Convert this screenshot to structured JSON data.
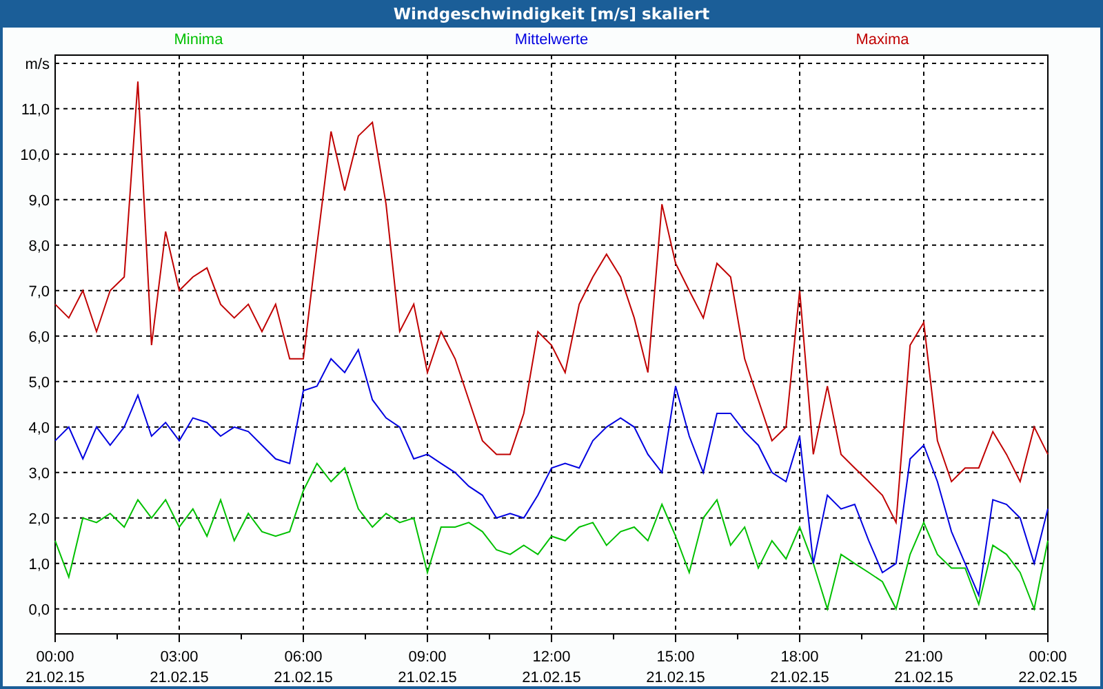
{
  "chart_data": {
    "type": "line",
    "title": "Windgeschwindigkeit [m/s] skaliert",
    "x": [
      0,
      0.33,
      0.67,
      1,
      1.33,
      1.67,
      2,
      2.33,
      2.67,
      3,
      3.33,
      3.67,
      4,
      4.33,
      4.67,
      5,
      5.33,
      5.67,
      6,
      6.33,
      6.67,
      7,
      7.33,
      7.67,
      8,
      8.33,
      8.67,
      9,
      9.33,
      9.67,
      10,
      10.33,
      10.67,
      11,
      11.33,
      11.67,
      12,
      12.33,
      12.67,
      13,
      13.33,
      13.67,
      14,
      14.33,
      14.67,
      15,
      15.33,
      15.67,
      16,
      16.33,
      16.67,
      17,
      17.33,
      17.67,
      18,
      18.33,
      18.67,
      19,
      19.33,
      19.67,
      20,
      20.33,
      20.67,
      21,
      21.33,
      21.67,
      22,
      22.33,
      22.67,
      23,
      23.33,
      23.67,
      24
    ],
    "series": [
      {
        "name": "Minima",
        "color": "#00c000",
        "values": [
          1.5,
          0.7,
          2.0,
          1.9,
          2.1,
          1.8,
          2.4,
          2.0,
          2.4,
          1.8,
          2.2,
          1.6,
          2.4,
          1.5,
          2.1,
          1.7,
          1.6,
          1.7,
          2.6,
          3.2,
          2.8,
          3.1,
          2.2,
          1.8,
          2.1,
          1.9,
          2.0,
          0.8,
          1.8,
          1.8,
          1.9,
          1.7,
          1.3,
          1.2,
          1.4,
          1.2,
          1.6,
          1.5,
          1.8,
          1.9,
          1.4,
          1.7,
          1.8,
          1.5,
          2.3,
          1.6,
          0.8,
          2.0,
          2.4,
          1.4,
          1.8,
          0.9,
          1.5,
          1.1,
          1.8,
          1.0,
          0.0,
          1.2,
          1.0,
          0.8,
          0.6,
          0.0,
          1.2,
          1.9,
          1.2,
          0.9,
          0.9,
          0.1,
          1.4,
          1.2,
          0.8,
          0.0,
          1.5
        ]
      },
      {
        "name": "Mittelwerte",
        "color": "#0000e0",
        "values": [
          3.7,
          4.0,
          3.3,
          4.0,
          3.6,
          4.0,
          4.7,
          3.8,
          4.1,
          3.7,
          4.2,
          4.1,
          3.8,
          4.0,
          3.9,
          3.6,
          3.3,
          3.2,
          4.8,
          4.9,
          5.5,
          5.2,
          5.7,
          4.6,
          4.2,
          4.0,
          3.3,
          3.4,
          3.2,
          3.0,
          2.7,
          2.5,
          2.0,
          2.1,
          2.0,
          2.5,
          3.1,
          3.2,
          3.1,
          3.7,
          4.0,
          4.2,
          4.0,
          3.4,
          3.0,
          4.9,
          3.8,
          3.0,
          4.3,
          4.3,
          3.9,
          3.6,
          3.0,
          2.8,
          3.8,
          1.0,
          2.5,
          2.2,
          2.3,
          1.5,
          0.8,
          1.0,
          3.3,
          3.6,
          2.8,
          1.7,
          1.0,
          0.3,
          2.4,
          2.3,
          2.0,
          1.0,
          2.2
        ]
      },
      {
        "name": "Maxima",
        "color": "#c00000",
        "values": [
          6.7,
          6.4,
          7.0,
          6.1,
          7.0,
          7.3,
          11.6,
          5.8,
          8.3,
          7.0,
          7.3,
          7.5,
          6.7,
          6.4,
          6.7,
          6.1,
          6.7,
          5.5,
          5.5,
          8.0,
          10.5,
          9.2,
          10.4,
          10.7,
          8.9,
          6.1,
          6.7,
          5.2,
          6.1,
          5.5,
          4.6,
          3.7,
          3.4,
          3.4,
          4.3,
          6.1,
          5.8,
          5.2,
          6.7,
          7.3,
          7.8,
          7.3,
          6.4,
          5.2,
          8.9,
          7.6,
          7.0,
          6.4,
          7.6,
          7.3,
          5.5,
          4.6,
          3.7,
          4.0,
          7.0,
          3.4,
          4.9,
          3.4,
          3.1,
          2.8,
          2.5,
          1.9,
          5.8,
          6.3,
          3.7,
          2.8,
          3.1,
          3.1,
          3.9,
          3.4,
          2.8,
          4.0,
          3.4
        ]
      }
    ],
    "xlim": [
      0,
      24
    ],
    "ylim": [
      -0.55,
      12.18
    ],
    "grid": true,
    "xticks": [
      {
        "value": 0,
        "label": "00:00"
      },
      {
        "value": 3,
        "label": "03:00"
      },
      {
        "value": 6,
        "label": "06:00"
      },
      {
        "value": 9,
        "label": "09:00"
      },
      {
        "value": 12,
        "label": "12:00"
      },
      {
        "value": 15,
        "label": "15:00"
      },
      {
        "value": 18,
        "label": "18:00"
      },
      {
        "value": 21,
        "label": "21:00"
      },
      {
        "value": 24,
        "label": "00:00"
      }
    ],
    "yticks": [
      {
        "value": 0,
        "label": "0,0"
      },
      {
        "value": 1,
        "label": "1,0"
      },
      {
        "value": 2,
        "label": "2,0"
      },
      {
        "value": 3,
        "label": "3,0"
      },
      {
        "value": 4,
        "label": "4,0"
      },
      {
        "value": 5,
        "label": "5,0"
      },
      {
        "value": 6,
        "label": "6,0"
      },
      {
        "value": 7,
        "label": "7,0"
      },
      {
        "value": 8,
        "label": "8,0"
      },
      {
        "value": 9,
        "label": "9,0"
      },
      {
        "value": 10,
        "label": "10,0"
      },
      {
        "value": 11,
        "label": "11,0"
      },
      {
        "value": 12,
        "label": "m/s"
      }
    ]
  },
  "x_axis_dates": [
    "21.02.15",
    "21.02.15",
    "21.02.15",
    "21.02.15",
    "21.02.15",
    "21.02.15",
    "21.02.15",
    "21.02.15",
    "22.02.15"
  ]
}
